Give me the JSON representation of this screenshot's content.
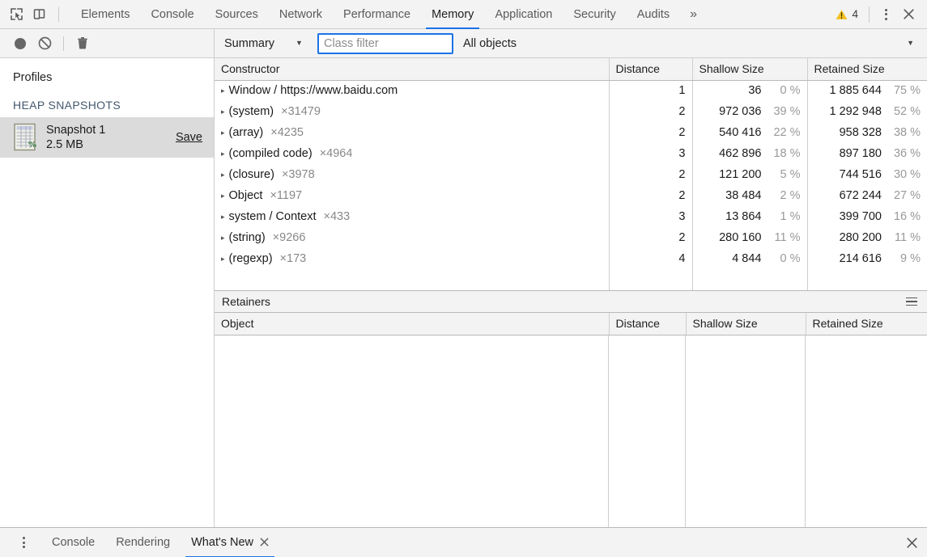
{
  "toolbar": {
    "inspect_icon": "inspect-cursor-icon",
    "device_icon": "device-toolbar-icon",
    "tabs": [
      {
        "label": "Elements",
        "active": false
      },
      {
        "label": "Console",
        "active": false
      },
      {
        "label": "Sources",
        "active": false
      },
      {
        "label": "Network",
        "active": false
      },
      {
        "label": "Performance",
        "active": false
      },
      {
        "label": "Memory",
        "active": true
      },
      {
        "label": "Application",
        "active": false
      },
      {
        "label": "Security",
        "active": false
      },
      {
        "label": "Audits",
        "active": false
      }
    ],
    "overflow_label": "»",
    "warning_count": "4",
    "warning_icon": "warning-triangle-icon",
    "more_icon": "kebab-menu-icon",
    "close_icon": "close-icon"
  },
  "left_toolbar": {
    "record_icon": "record-circle-icon",
    "clear_icon": "clear-no-entry-icon",
    "trash_icon": "trash-icon"
  },
  "sidebar": {
    "title": "Profiles",
    "section_label": "HEAP SNAPSHOTS",
    "snapshot": {
      "icon": "heap-snapshot-icon",
      "name": "Snapshot 1",
      "size": "2.5 MB",
      "save_label": "Save"
    }
  },
  "right_toolbar": {
    "view_select": "Summary",
    "caret": "▼",
    "filter_placeholder": "Class filter",
    "filter_value": "",
    "objects_select": "All objects"
  },
  "constructor_table": {
    "columns": [
      "Constructor",
      "Distance",
      "Shallow Size",
      "Retained Size"
    ],
    "expand_arrow": "▸",
    "rows": [
      {
        "constructor": "Window / https://www.baidu.com",
        "count": "",
        "distance": "1",
        "shallow": "36",
        "shallow_pct": "0 %",
        "retained": "1 885 644",
        "retained_pct": "75 %"
      },
      {
        "constructor": "(system)",
        "count": "×31479",
        "distance": "2",
        "shallow": "972 036",
        "shallow_pct": "39 %",
        "retained": "1 292 948",
        "retained_pct": "52 %"
      },
      {
        "constructor": "(array)",
        "count": "×4235",
        "distance": "2",
        "shallow": "540 416",
        "shallow_pct": "22 %",
        "retained": "958 328",
        "retained_pct": "38 %"
      },
      {
        "constructor": "(compiled code)",
        "count": "×4964",
        "distance": "3",
        "shallow": "462 896",
        "shallow_pct": "18 %",
        "retained": "897 180",
        "retained_pct": "36 %"
      },
      {
        "constructor": "(closure)",
        "count": "×3978",
        "distance": "2",
        "shallow": "121 200",
        "shallow_pct": "5 %",
        "retained": "744 516",
        "retained_pct": "30 %"
      },
      {
        "constructor": "Object",
        "count": "×1197",
        "distance": "2",
        "shallow": "38 484",
        "shallow_pct": "2 %",
        "retained": "672 244",
        "retained_pct": "27 %"
      },
      {
        "constructor": "system / Context",
        "count": "×433",
        "distance": "3",
        "shallow": "13 864",
        "shallow_pct": "1 %",
        "retained": "399 700",
        "retained_pct": "16 %"
      },
      {
        "constructor": "(string)",
        "count": "×9266",
        "distance": "2",
        "shallow": "280 160",
        "shallow_pct": "11 %",
        "retained": "280 200",
        "retained_pct": "11 %"
      },
      {
        "constructor": "(regexp)",
        "count": "×173",
        "distance": "4",
        "shallow": "4 844",
        "shallow_pct": "0 %",
        "retained": "214 616",
        "retained_pct": "9 %"
      }
    ]
  },
  "retainers": {
    "title": "Retainers",
    "menu_icon": "hamburger-menu-icon",
    "columns": [
      "Object",
      "Distance",
      "Shallow Size",
      "Retained Size"
    ],
    "rows": []
  },
  "drawer": {
    "more_icon": "kebab-menu-icon",
    "tabs": [
      {
        "label": "Console",
        "active": false,
        "closable": false
      },
      {
        "label": "Rendering",
        "active": false,
        "closable": false
      },
      {
        "label": "What's New",
        "active": true,
        "closable": true
      }
    ],
    "close_tab_icon": "close-icon",
    "close_icon": "close-icon"
  },
  "colors": {
    "accent": "#1a73e8",
    "toolbar_bg": "#f3f3f3",
    "selected_row": "#dbdbdb",
    "warning": "#f4c020",
    "muted_text": "#999999",
    "section_label": "#44586f"
  }
}
